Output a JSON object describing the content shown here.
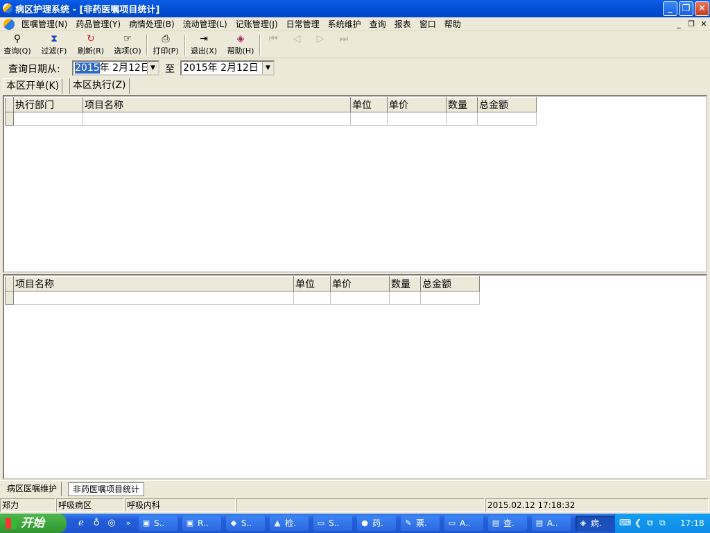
{
  "window": {
    "title": "病区护理系统 - [非药医嘱项目统计]"
  },
  "menu": [
    "医嘱管理(N)",
    "药品管理(Y)",
    "病情处理(B)",
    "流动管理(L)",
    "记账管理(J)",
    "日常管理",
    "系统维护",
    "查询",
    "报表",
    "窗口",
    "帮助"
  ],
  "toolbar": {
    "query": "查询(Q)",
    "filter": "过滤(F)",
    "refresh": "刷新(R)",
    "options": "选项(O)",
    "print": "打印(P)",
    "exit": "退出(X)",
    "help": "帮助(H)"
  },
  "datebar": {
    "label": "查询日期从:",
    "from_sel": "2015",
    "from_rest": "年 2月12日",
    "to_label": "至",
    "to": "2015年 2月12日"
  },
  "tabs": {
    "tab1": "本区开单(K)",
    "tab2": "本区执行(Z)"
  },
  "grid1": {
    "headers": [
      "执行部门",
      "项目名称",
      "单位",
      "单价",
      "数量",
      "总金额"
    ]
  },
  "grid2": {
    "headers": [
      "项目名称",
      "单位",
      "单价",
      "数量",
      "总金额"
    ]
  },
  "bottom_tabs": {
    "tab1": "病区医嘱维护",
    "tab2": "非药医嘱项目统计"
  },
  "status": {
    "user": "郑力",
    "ward": "呼吸病区",
    "dept": "呼吸内科",
    "datetime": "2015.02.12 17:18:32"
  },
  "taskbar": {
    "start": "开始",
    "items": [
      "S..",
      "R..",
      "S..",
      "检.",
      "S..",
      "药.",
      "票.",
      "A..",
      "查.",
      "A..",
      "病."
    ],
    "clock": "17:18"
  }
}
